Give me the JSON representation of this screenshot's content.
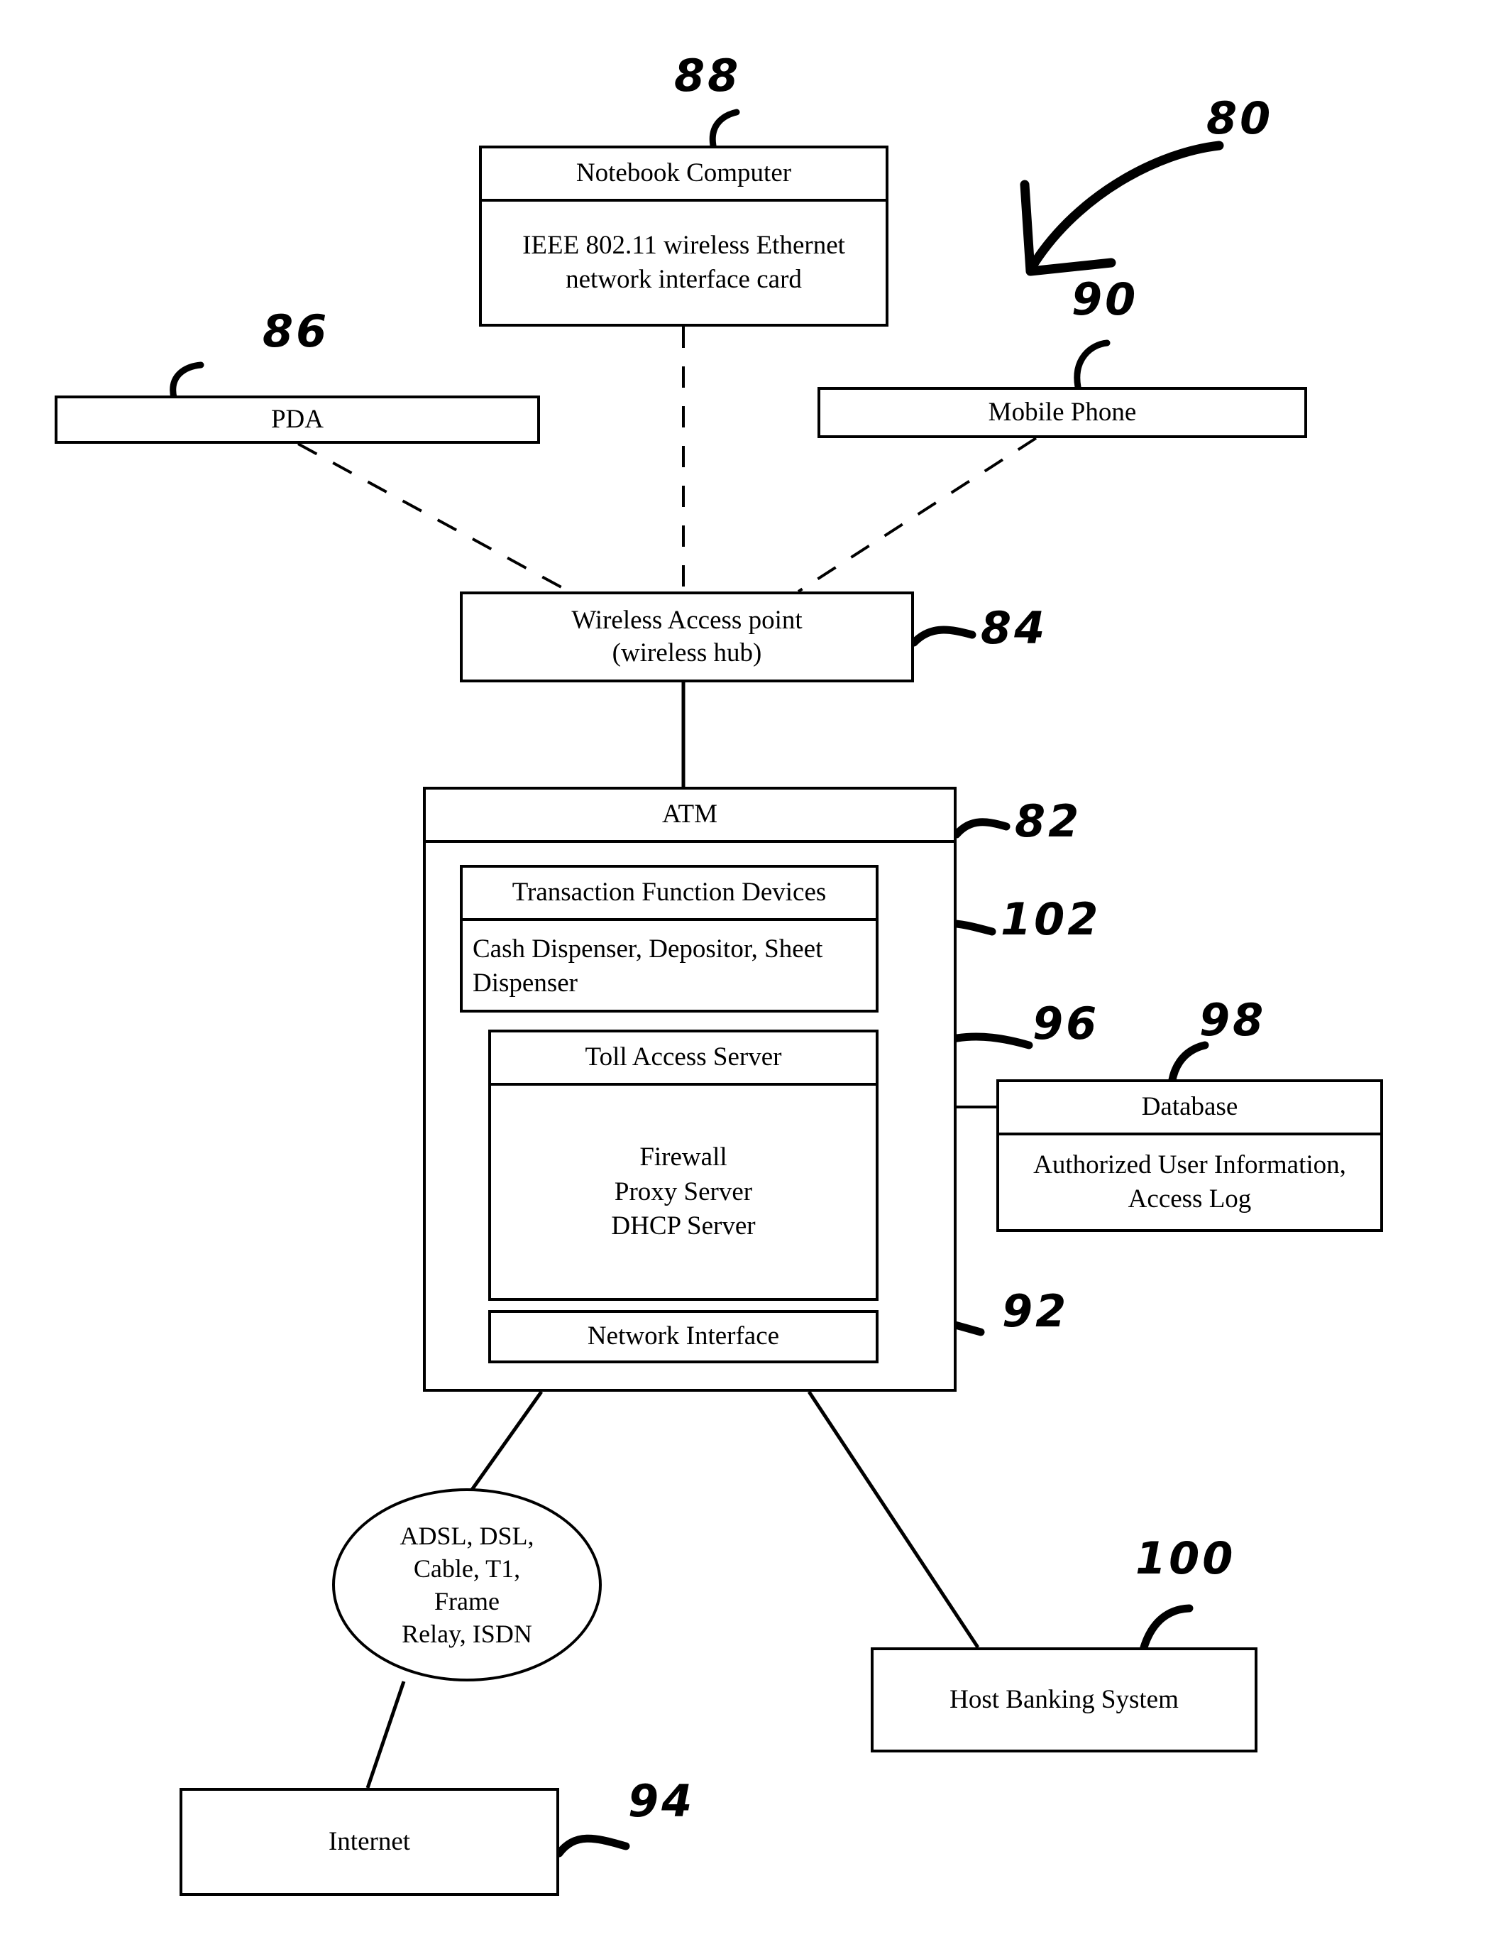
{
  "figure": {
    "type": "patent-diagram",
    "title": "Wireless ATM network system block diagram"
  },
  "nodes": {
    "notebook": {
      "header": "Notebook Computer",
      "body": "IEEE 802.11 wireless Ethernet network interface card"
    },
    "pda": {
      "label": "PDA"
    },
    "mobile_phone": {
      "label": "Mobile Phone"
    },
    "wireless_access_point": {
      "label": "Wireless Access point\n(wireless hub)"
    },
    "atm": {
      "header": "ATM"
    },
    "transaction_function_devices": {
      "header": "Transaction Function Devices",
      "body": "Cash Dispenser, Depositor, Sheet Dispenser"
    },
    "toll_access_server": {
      "header": "Toll Access Server",
      "body": "Firewall\nProxy Server\nDHCP Server"
    },
    "network_interface": {
      "label": "Network Interface"
    },
    "database": {
      "header": "Database",
      "body": "Authorized User Information, Access Log"
    },
    "wan_cloud": {
      "label": "ADSL, DSL,\nCable, T1,\nFrame\nRelay, ISDN"
    },
    "internet": {
      "label": "Internet"
    },
    "host_banking_system": {
      "label": "Host Banking System"
    }
  },
  "reference_numerals": {
    "system": "80",
    "atm": "82",
    "wireless_access_point": "84",
    "pda": "86",
    "notebook": "88",
    "mobile_phone": "90",
    "network_interface": "92",
    "internet": "94",
    "toll_access_server": "96",
    "database": "98",
    "host_banking_system": "100",
    "transaction_function_devices": "102"
  },
  "colors": {
    "line": "#000000",
    "background": "#ffffff"
  }
}
